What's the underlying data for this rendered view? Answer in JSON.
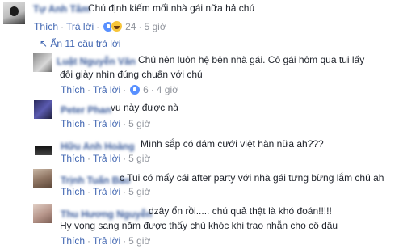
{
  "top_comment": {
    "author": "Tự Anh Tâm",
    "text": "Chú định kiếm mối nhà gái nữa hả chú",
    "like": "Thích",
    "reply": "Trả lời",
    "reaction_count": "24",
    "time": "5 giờ"
  },
  "hide_replies": {
    "label": "Ẩn 11 câu trả lời"
  },
  "replies": [
    {
      "author": "Luật Nguyễn Văn",
      "lines": [
        "Chú nên luôn hệ bên nhà gái. Cô gái hôm qua tui lấy",
        "đôi giày nhìn đúng chuẩn với chú"
      ],
      "like": "Thích",
      "reply": "Trả lời",
      "reaction_count": "6",
      "time": "4 giờ"
    },
    {
      "author": "Peter Phan",
      "lines": [
        "vụ này được nà"
      ],
      "like": "Thích",
      "reply": "Trả lời",
      "reaction_count": "",
      "time": "5 giờ"
    },
    {
      "author": "Hữu Anh Hoàng",
      "lines": [
        "Mình sắp có đám cưới việt hàn nữa ah???"
      ],
      "like": "Thích",
      "reply": "Trả lời",
      "reaction_count": "",
      "time": "5 giờ"
    },
    {
      "author": "Trịnh Tuấn Bảo",
      "lines": [
        "c Tui có mấy cái after party với nhà gái tưng bừng lắm chú ah"
      ],
      "like": "Thích",
      "reply": "Trả lời",
      "reaction_count": "",
      "time": "5 giờ"
    },
    {
      "author": "Thu Hương Nguyễn",
      "lines": [
        "dzây ổn rồi..... chú quả thật là khó đoán!!!!!",
        "Hy vọng sang năm được thấy chú khóc khi trao nhẫn cho cô dâu"
      ],
      "like": "Thích",
      "reply": "Trả lời",
      "reaction_count": "",
      "time": "5 giờ"
    }
  ],
  "colors": {
    "link": "#4267b2",
    "name": "#365899",
    "meta": "#90949c",
    "text": "#1d2129"
  }
}
